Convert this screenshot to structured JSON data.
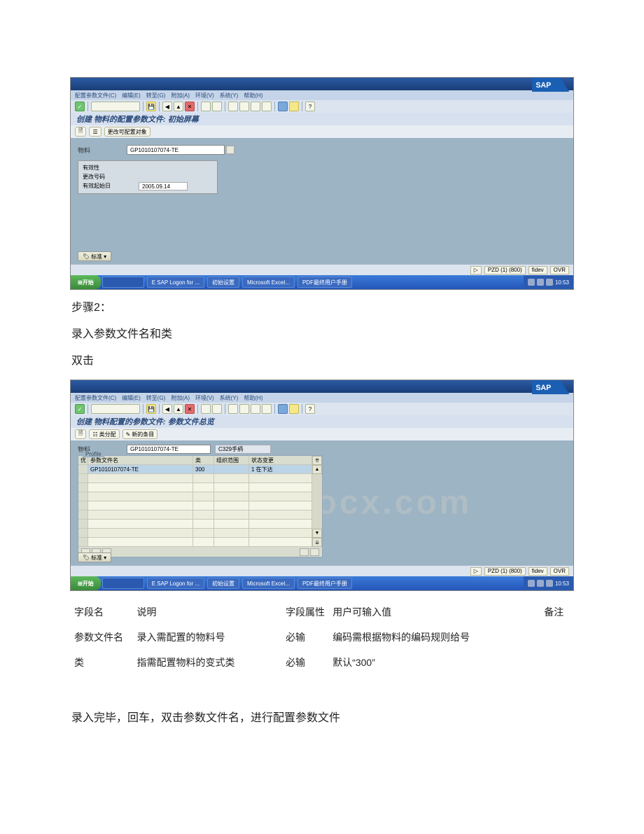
{
  "sap_logo_text": "SAP",
  "menus": {
    "profile": "配置参数文件(C)",
    "edit": "编辑(E)",
    "goto": "转至(G)",
    "extras": "附加(A)",
    "env": "环境(V)",
    "system": "系统(Y)",
    "help": "帮助(H)"
  },
  "screen1": {
    "page_title": "创建 物料的配置参数文件: 初始屏幕",
    "sub_btn1": "更改可配置对象",
    "material_label": "物料",
    "material_value": "GP1010107074-TE",
    "eff_group_title": "有效性",
    "change_no_label": "更改号码",
    "valid_from_label": "有效起始日",
    "valid_from_value": "2005.09.14"
  },
  "screen2": {
    "page_title": "创建 物料配置的参数文件: 参数文件总览",
    "sub_btn1": "类分配",
    "sub_btn2": "新的条目",
    "material_label": "物料",
    "material_value": "GP1010107074-TE",
    "material_desc": "C329手柄",
    "group_label": "Profile",
    "headers": {
      "pri": "优",
      "name": "参数文件名",
      "cls": "类",
      "org": "组织范围",
      "status": "状态变更"
    },
    "row1": {
      "name": "GP1010107074-TE",
      "cls": "300",
      "org": "",
      "status": "1 在下达"
    }
  },
  "tag_btn": "标准",
  "status_bar": {
    "system": "PZD (1) (800)",
    "server": "fidev",
    "mode": "OVR"
  },
  "taskbar": {
    "start": "开始",
    "item1": "E SAP Logon for ...",
    "item2": "初始设置",
    "item3": "Microsoft Excel...",
    "item4": "PDF最终用户手册",
    "time": "10:53"
  },
  "doc": {
    "step2": "步骤2：",
    "enter_name": "录入参数文件名和类",
    "dblclick": "双击",
    "table_header": {
      "field": "字段名",
      "desc": "说明",
      "attr": "字段属性",
      "val": "用户可输入值",
      "note": "备注"
    },
    "rows": [
      {
        "field": "参数文件名",
        "desc": "录入需配置的物料号",
        "attr": "必输",
        "val": "编码需根据物料的编码规则给号",
        "note": ""
      },
      {
        "field": "类",
        "desc": "指需配置物料的变式类",
        "attr": "必输",
        "val": "默认“300”",
        "note": ""
      }
    ],
    "closing": "录入完毕，回车，双击参数文件名，进行配置参数文件"
  },
  "watermark": "www.bdocx.com"
}
